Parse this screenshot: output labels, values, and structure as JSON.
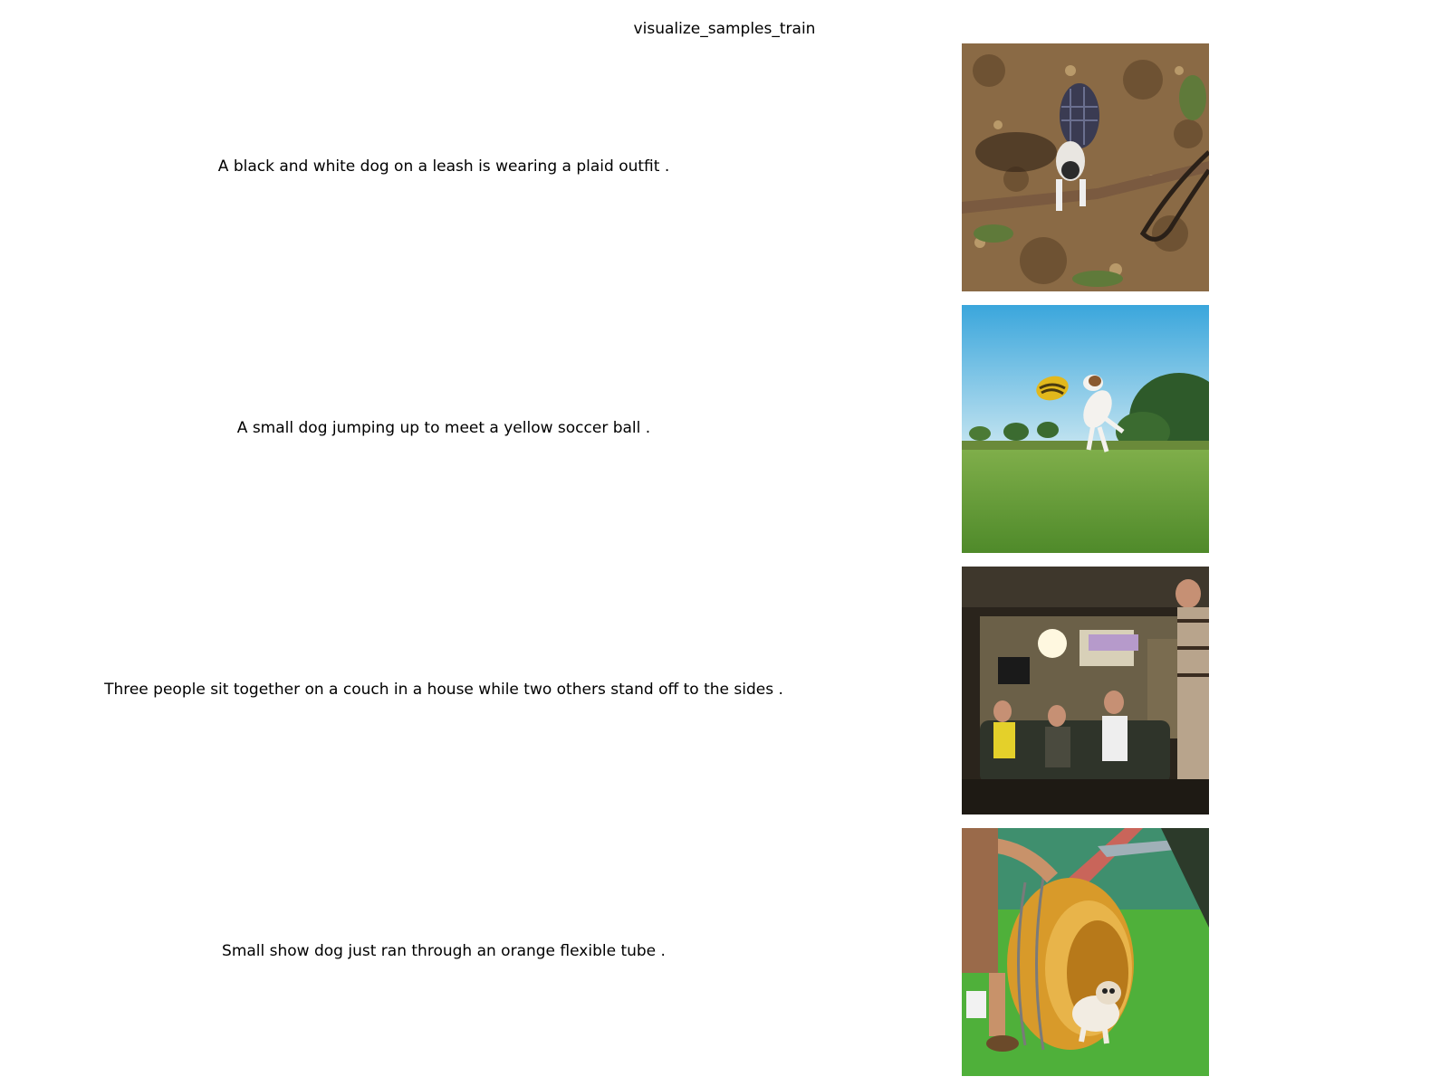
{
  "figure": {
    "title": "visualize_samples_train"
  },
  "samples": [
    {
      "caption": "A black and white dog on a leash is wearing a plaid outfit .",
      "image_icon": "dog-on-leash-photo"
    },
    {
      "caption": "A small dog jumping up to meet a yellow soccer ball .",
      "image_icon": "dog-jumping-soccer-ball-photo"
    },
    {
      "caption": "Three people sit together on a couch in a house while two others stand off to the sides .",
      "image_icon": "people-on-couch-photo"
    },
    {
      "caption": "Small show dog just ran through an orange flexible tube .",
      "image_icon": "dog-agility-tube-photo"
    }
  ]
}
